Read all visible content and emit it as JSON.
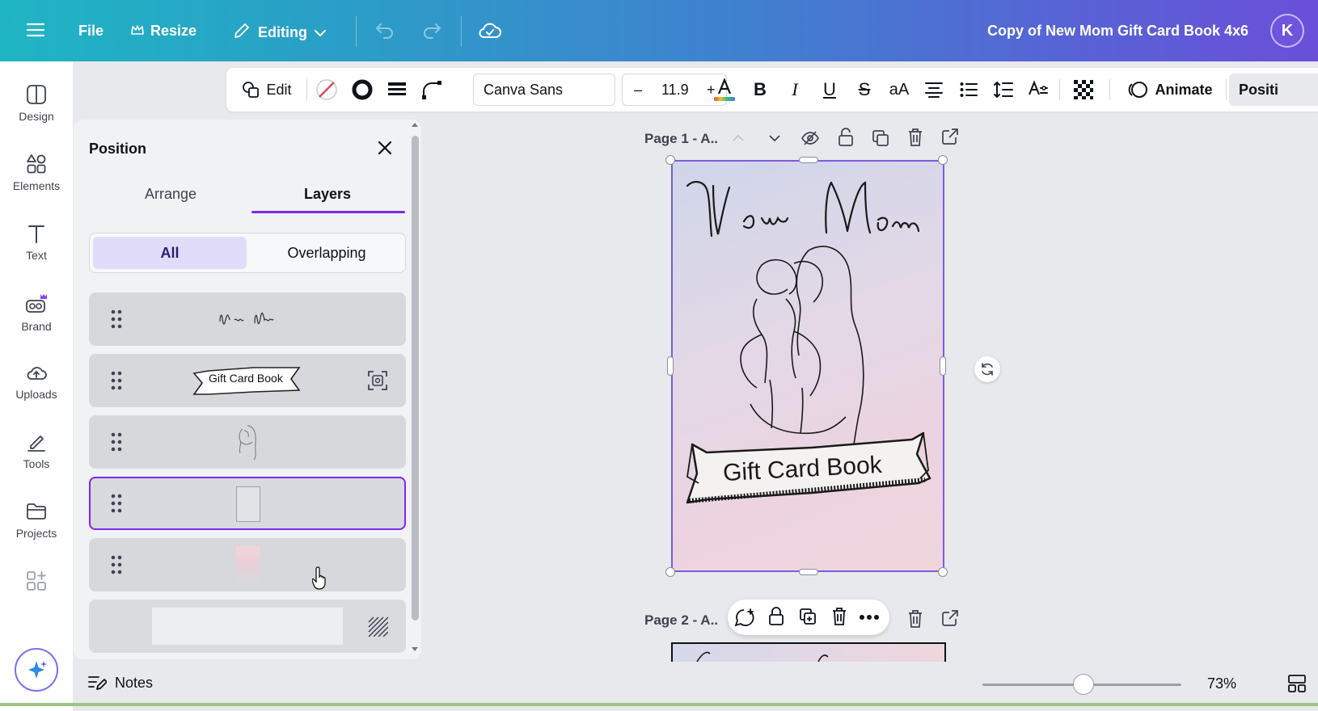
{
  "header": {
    "file_label": "File",
    "resize_label": "Resize",
    "editing_label": "Editing",
    "doc_title": "Copy of New Mom Gift Card Book 4x6",
    "avatar_initial": "K"
  },
  "rail": {
    "items": [
      {
        "label": "Design",
        "icon": "design-icon"
      },
      {
        "label": "Elements",
        "icon": "elements-icon"
      },
      {
        "label": "Text",
        "icon": "text-icon"
      },
      {
        "label": "Brand",
        "icon": "brand-icon"
      },
      {
        "label": "Uploads",
        "icon": "uploads-icon"
      },
      {
        "label": "Tools",
        "icon": "tools-icon"
      },
      {
        "label": "Projects",
        "icon": "projects-icon"
      },
      {
        "label": "",
        "icon": "apps-icon"
      }
    ]
  },
  "toolbar": {
    "edit_label": "Edit",
    "font_name": "Canva Sans",
    "font_size": "11.9",
    "minus": "–",
    "plus": "+",
    "animate_label": "Animate",
    "position_label": "Positi"
  },
  "panel": {
    "title": "Position",
    "tab_arrange": "Arrange",
    "tab_layers": "Layers",
    "filter_all": "All",
    "filter_overlapping": "Overlapping",
    "layers": [
      {
        "preview": "New Mom",
        "kind": "script-text"
      },
      {
        "preview": "Gift Card Book",
        "kind": "banner"
      },
      {
        "preview": "",
        "kind": "illustration"
      },
      {
        "preview": "",
        "kind": "frame",
        "selected": true
      },
      {
        "preview": "",
        "kind": "gradient"
      },
      {
        "preview": "",
        "kind": "background"
      }
    ]
  },
  "canvas": {
    "page1_label": "Page 1 - A..",
    "page2_label": "Page 2 - A..",
    "card_title": "New Mom",
    "banner_text": "Gift Card Book"
  },
  "footer": {
    "notes_label": "Notes",
    "zoom": "73%"
  },
  "colors": {
    "accent": "#7d2ae8",
    "header_start": "#1fb5c4",
    "header_end": "#6a4fd9"
  }
}
